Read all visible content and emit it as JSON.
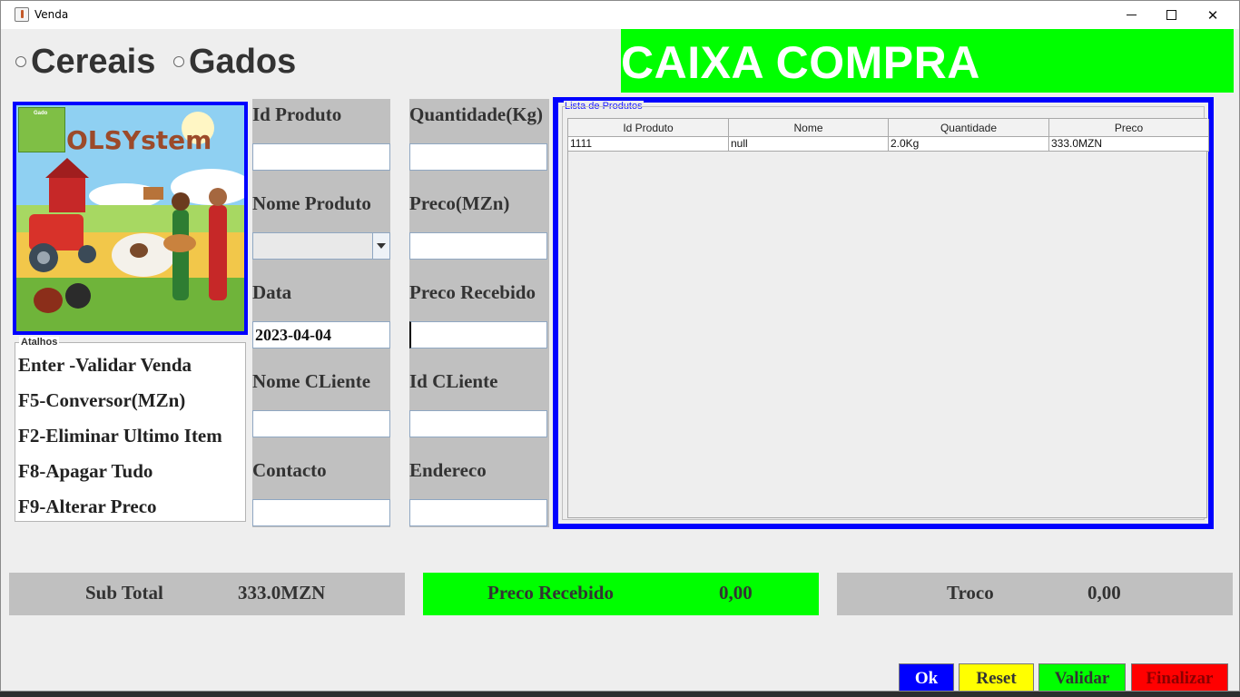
{
  "window": {
    "title": "Venda"
  },
  "radios": {
    "cereais": "Cereais",
    "gados": "Gados"
  },
  "banner": {
    "text": "CAIXA COMPRA"
  },
  "logo": {
    "brand": "OLSYstem",
    "badge": "Gado"
  },
  "shortcuts": {
    "legend": "Atalhos",
    "items": [
      "Enter -Validar Venda",
      "F5-Conversor(MZn)",
      "F2-Eliminar Ultimo Item",
      "F8-Apagar Tudo",
      "F9-Alterar Preco"
    ]
  },
  "form": {
    "id_produto_label": "Id Produto",
    "id_produto_value": "",
    "quantidade_label": "Quantidade(Kg)",
    "quantidade_value": "",
    "nome_produto_label": "Nome Produto",
    "nome_produto_value": "",
    "preco_label": "Preco(MZn)",
    "preco_value": "",
    "data_label": "Data",
    "data_value": "2023-04-04",
    "preco_recebido_label": "Preco Recebido",
    "preco_recebido_value": "",
    "nome_cliente_label": "Nome CLiente",
    "nome_cliente_value": "",
    "id_cliente_label": "Id CLiente",
    "id_cliente_value": "",
    "contacto_label": "Contacto",
    "contacto_value": "",
    "endereco_label": "Endereco",
    "endereco_value": ""
  },
  "product_list": {
    "legend": "Lista de Produtos",
    "columns": [
      "Id Produto",
      "Nome",
      "Quantidade",
      "Preco"
    ],
    "rows": [
      [
        "1111",
        "null",
        "2.0Kg",
        "333.0MZN"
      ]
    ]
  },
  "totals": {
    "subtotal_label": "Sub Total",
    "subtotal_value": "333.0MZN",
    "recebido_label": "Preco Recebido",
    "recebido_value": "0,00",
    "troco_label": "Troco",
    "troco_value": "0,00"
  },
  "buttons": {
    "ok": "Ok",
    "reset": "Reset",
    "validar": "Validar",
    "finalizar": "Finalizar"
  },
  "colors": {
    "banner_green": "#00ff00",
    "list_border_blue": "#0000ff",
    "ok_blue": "#0000ff",
    "reset_yellow": "#ffff00",
    "validar_green": "#00ff00",
    "finalizar_red": "#ff0000"
  }
}
